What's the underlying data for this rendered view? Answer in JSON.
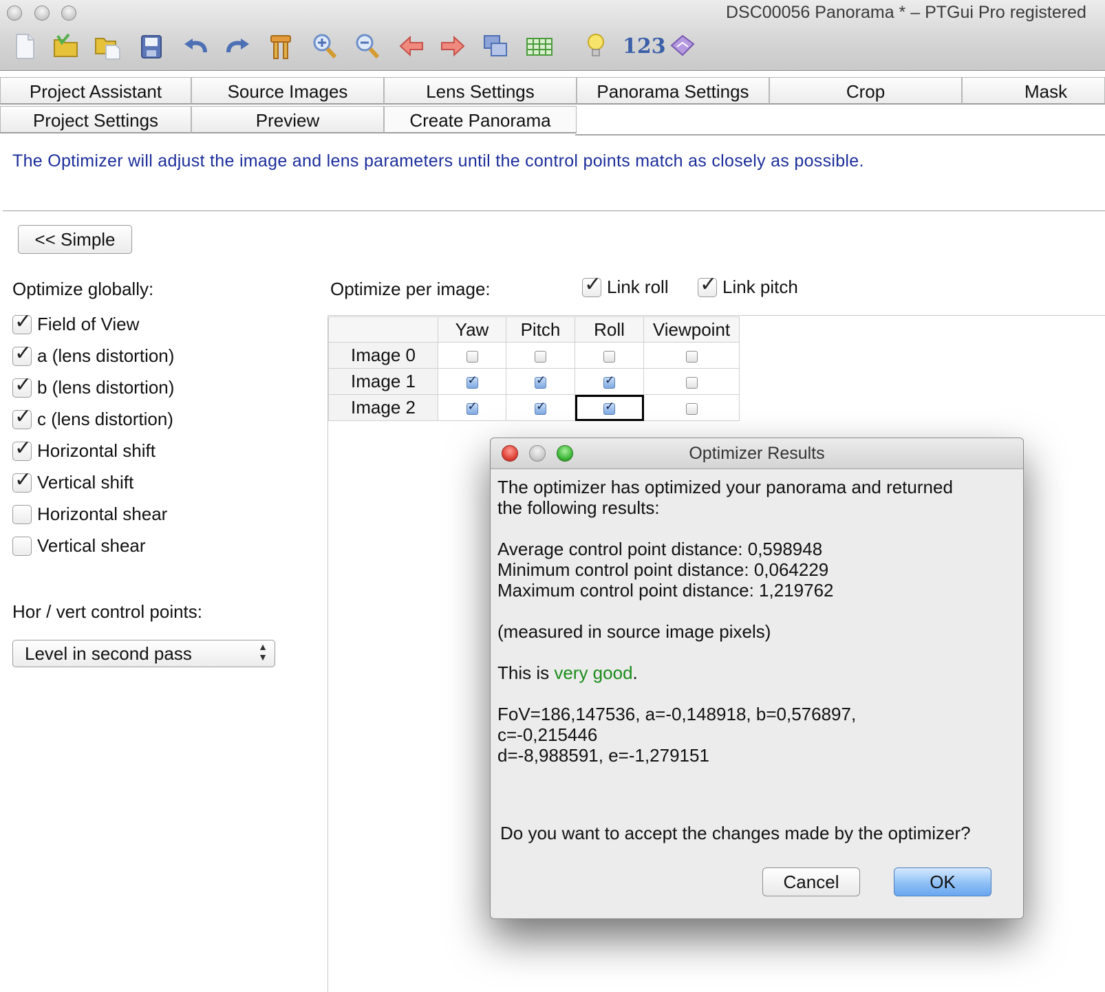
{
  "window": {
    "title": "DSC00056 Panorama * – PTGui Pro registered"
  },
  "toolbar": {
    "icons": [
      "new-document-icon",
      "open-folder-icon",
      "open-recent-icon",
      "save-icon",
      "undo-icon",
      "redo-icon",
      "tools-icon",
      "zoom-in-icon",
      "zoom-out-icon",
      "arrow-left-icon",
      "arrow-right-icon",
      "images-icon",
      "table-icon",
      "lightbulb-icon",
      "numbers-icon",
      "help-book-icon"
    ],
    "numbers_label": "123"
  },
  "tabs": {
    "row1": [
      "Project Assistant",
      "Source Images",
      "Lens Settings",
      "Panorama Settings",
      "Crop",
      "Mask"
    ],
    "row2": [
      "Project Settings",
      "Preview",
      "Create Panorama"
    ]
  },
  "info_text": "The Optimizer will adjust the image and lens parameters until the control points match as closely as possible.",
  "simple_button": "<< Simple",
  "optimize_globally": {
    "label": "Optimize globally:",
    "items": [
      {
        "label": "Field of View",
        "checked": true
      },
      {
        "label": "a (lens distortion)",
        "checked": true
      },
      {
        "label": "b (lens distortion)",
        "checked": true
      },
      {
        "label": "c (lens distortion)",
        "checked": true
      },
      {
        "label": "Horizontal shift",
        "checked": true
      },
      {
        "label": "Vertical shift",
        "checked": true
      },
      {
        "label": "Horizontal shear",
        "checked": false
      },
      {
        "label": "Vertical shear",
        "checked": false
      }
    ]
  },
  "control_points": {
    "label": "Hor / vert control points:",
    "selected": "Level in second pass"
  },
  "optimize_per_image": {
    "label": "Optimize per image:",
    "link_roll": {
      "label": "Link roll",
      "checked": true
    },
    "link_pitch": {
      "label": "Link pitch",
      "checked": true
    },
    "columns": [
      "Yaw",
      "Pitch",
      "Roll",
      "Viewpoint"
    ],
    "rows": [
      {
        "name": "Image 0",
        "values": [
          false,
          false,
          false,
          false
        ]
      },
      {
        "name": "Image 1",
        "values": [
          true,
          true,
          true,
          false
        ]
      },
      {
        "name": "Image 2",
        "values": [
          true,
          true,
          true,
          false
        ]
      }
    ]
  },
  "dialog": {
    "title": "Optimizer Results",
    "intro_line1": "The optimizer has optimized your panorama and returned",
    "intro_line2": "the following results:",
    "avg": "Average control point distance: 0,598948",
    "min": "Minimum control point distance: 0,064229",
    "max": "Maximum control point distance: 1,219762",
    "measured": "(measured in source image pixels)",
    "verdict_prefix": "This is ",
    "verdict": "very good",
    "verdict_suffix": ".",
    "params_line1": "FoV=186,147536, a=-0,148918, b=0,576897,",
    "params_line2": "c=-0,215446",
    "params_line3": "d=-8,988591, e=-1,279151",
    "question": "Do you want to accept the changes made by the optimizer?",
    "cancel": "Cancel",
    "ok": "OK"
  }
}
